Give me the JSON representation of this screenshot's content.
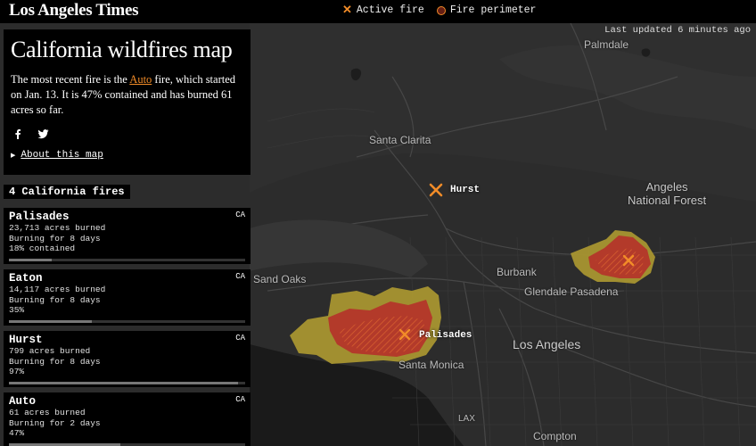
{
  "header": {
    "brand": "Los Angeles Times",
    "legend": [
      {
        "icon": "x-marker-icon",
        "label": "Active fire"
      },
      {
        "icon": "perimeter-circle-icon",
        "label": "Fire perimeter"
      }
    ]
  },
  "map": {
    "last_updated": "Last updated 6 minutes ago",
    "places": {
      "palmdale": "Palmdale",
      "santa_clarita": "Santa Clarita",
      "angeles_1": "Angeles",
      "angeles_2": "National Forest",
      "burbank": "Burbank",
      "glendale_pasadena": "Glendale Pasadena",
      "los_angeles": "Los Angeles",
      "santa_monica": "Santa Monica",
      "sand_oaks": "Sand Oaks",
      "lax": "LAX",
      "compton": "Compton"
    },
    "fire_labels": {
      "hurst": "Hurst",
      "palisades": "Palisades"
    },
    "colors": {
      "active_fire": "#f28c28",
      "perimeter_fill": "#b33a2a",
      "spread_fill": "#a89530"
    }
  },
  "info": {
    "title": "California wildfires map",
    "body_pre": "The most recent fire is the ",
    "body_link": "Auto",
    "body_post": " fire, which started on Jan. 13. It is 47% contained and has burned 61 acres so far.",
    "social": [
      "facebook-icon",
      "twitter-icon"
    ],
    "about": "About this map"
  },
  "fires_count": "4 California fires",
  "fires": [
    {
      "name": "Palisades",
      "state": "CA",
      "acres": "23,713 acres burned",
      "burning": "Burning for 8 days",
      "contained": "18% contained",
      "contained_pct": 18
    },
    {
      "name": "Eaton",
      "state": "CA",
      "acres": "14,117 acres burned",
      "burning": "Burning for 8 days",
      "contained": "35%",
      "contained_pct": 35
    },
    {
      "name": "Hurst",
      "state": "CA",
      "acres": "799 acres burned",
      "burning": "Burning for 8 days",
      "contained": "97%",
      "contained_pct": 97
    },
    {
      "name": "Auto",
      "state": "CA",
      "acres": "61 acres burned",
      "burning": "Burning for 2 days",
      "contained": "47%",
      "contained_pct": 47
    }
  ]
}
